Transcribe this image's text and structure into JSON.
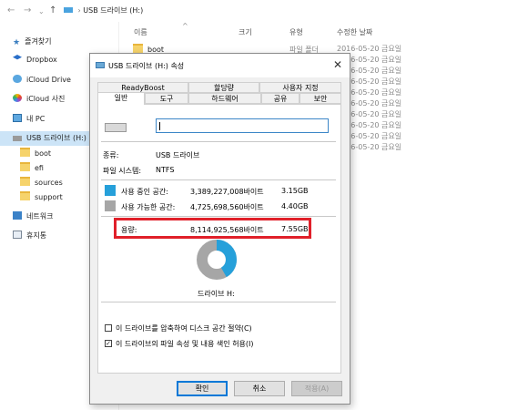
{
  "explorer": {
    "address": "USB 드라이브 (H:)",
    "columns": [
      "이름",
      "크기",
      "유형",
      "수정한 날짜"
    ],
    "sidebar": [
      {
        "label": "즐겨찾기",
        "icon": "star-icon"
      },
      {
        "label": "Dropbox",
        "icon": "dropbox-icon"
      },
      {
        "label": "iCloud Drive",
        "icon": "cloud-icon"
      },
      {
        "label": "iCloud 사진",
        "icon": "photos-icon"
      },
      {
        "label": "내 PC",
        "icon": "pc-icon"
      },
      {
        "label": "USB 드라이브 (H:)",
        "icon": "usb-drive-icon"
      },
      {
        "label": "boot",
        "icon": "folder-icon"
      },
      {
        "label": "efi",
        "icon": "folder-icon"
      },
      {
        "label": "sources",
        "icon": "folder-icon"
      },
      {
        "label": "support",
        "icon": "folder-icon"
      },
      {
        "label": "네트워크",
        "icon": "network-icon"
      },
      {
        "label": "휴지통",
        "icon": "recycle-bin-icon"
      }
    ],
    "first_file": {
      "name": "boot",
      "type": "파일 폴더"
    },
    "dates": [
      "2016-05-20 금요일",
      "2016-05-20 금요일",
      "2016-05-20 금요일",
      "2016-05-20 금요일",
      "2016-05-20 금요일",
      "2016-05-20 금요일",
      "2016-05-20 금요일",
      "2016-05-20 금요일",
      "2016-05-20 금요일",
      "2016-05-20 금요일"
    ]
  },
  "dialog": {
    "title": "USB 드라이브 (H:) 속성",
    "tabs_row1": [
      "ReadyBoost",
      "할당량",
      "사용자 지정"
    ],
    "tabs_row2": [
      "일반",
      "도구",
      "하드웨어",
      "공유",
      "보안"
    ],
    "name_value": "",
    "type_label": "종류:",
    "type_value": "USB 드라이브",
    "fs_label": "파일 시스템:",
    "fs_value": "NTFS",
    "used": {
      "label": "사용 중인 공간:",
      "bytes": "3,389,227,008바이트",
      "gb": "3.15GB",
      "color": "#26a0da"
    },
    "free": {
      "label": "사용 가능한 공간:",
      "bytes": "4,725,698,560바이트",
      "gb": "4.40GB",
      "color": "#a6a6a6"
    },
    "capacity": {
      "label": "용량:",
      "bytes": "8,114,925,568바이트",
      "gb": "7.55GB"
    },
    "used_fraction": 0.4177,
    "drive_label": "드라이브 H:",
    "compress_label": "이 드라이브를 압축하여 디스크 공간 절약(C)",
    "compress_checked": false,
    "index_label": "이 드라이브의 파일 속성 및 내용 색인 허용(I)",
    "index_checked": true,
    "buttons": {
      "ok": "확인",
      "cancel": "취소",
      "apply": "적용(A)"
    }
  }
}
